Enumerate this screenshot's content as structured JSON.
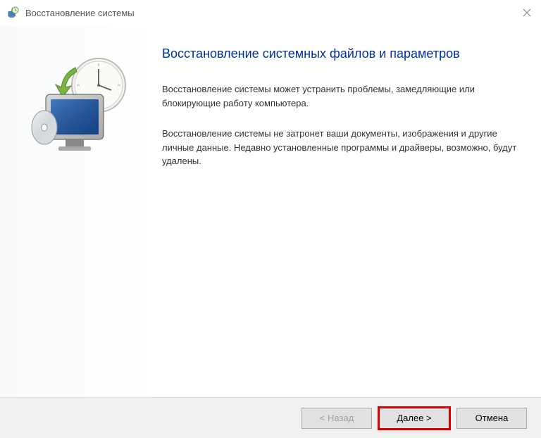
{
  "titlebar": {
    "title": "Восстановление системы"
  },
  "content": {
    "heading": "Восстановление системных файлов и параметров",
    "paragraph1": "Восстановление системы может устранить проблемы, замедляющие или блокирующие работу компьютера.",
    "paragraph2": "Восстановление системы не затронет ваши документы, изображения и другие личные данные. Недавно установленные программы и драйверы, возможно, будут удалены."
  },
  "buttons": {
    "back": "< Назад",
    "next": "Далее >",
    "cancel": "Отмена"
  }
}
